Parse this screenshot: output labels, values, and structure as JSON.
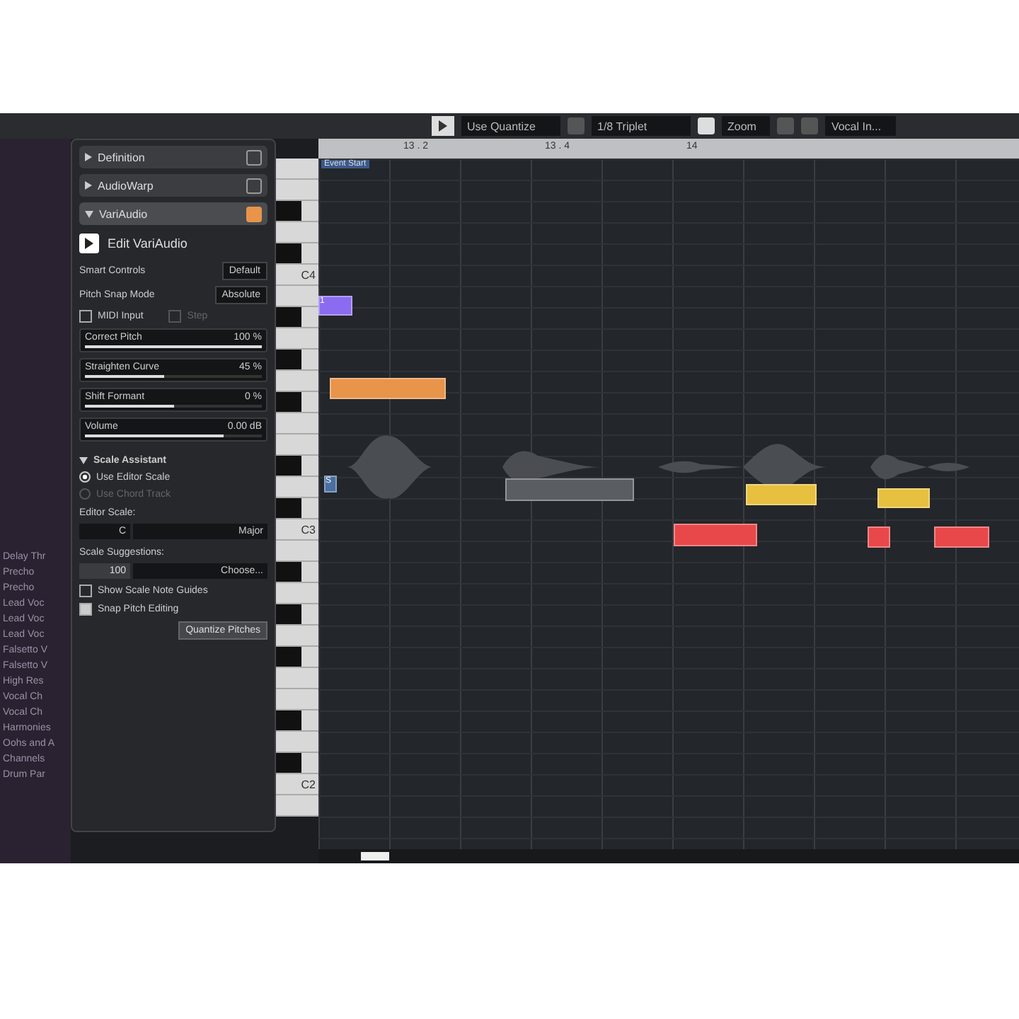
{
  "toolbar": {
    "quantize_mode": "Use Quantize",
    "quantize_value": "1/8 Triplet",
    "zoom": "Zoom",
    "track": "Vocal In..."
  },
  "track_list": [
    "Delay Thr",
    "Precho",
    "Precho",
    "Lead Voc",
    "Lead Voc",
    "Lead Voc",
    "Falsetto V",
    "Falsetto V",
    "High Res",
    "Vocal Ch",
    "Vocal Ch",
    "Harmonies",
    "Oohs and A",
    "Channels",
    "Drum Par"
  ],
  "inspector": {
    "sections": [
      {
        "label": "Definition",
        "expanded": false
      },
      {
        "label": "AudioWarp",
        "expanded": false
      },
      {
        "label": "VariAudio",
        "expanded": true,
        "on": true
      }
    ],
    "edit_button": "Edit VariAudio",
    "dropdowns": [
      {
        "label": "Smart Controls",
        "value": "Default"
      },
      {
        "label": "Pitch Snap Mode",
        "value": "Absolute"
      }
    ],
    "checks": [
      {
        "label": "MIDI Input",
        "checked": false,
        "disabled": false
      },
      {
        "label": "Step",
        "checked": false,
        "disabled": true
      }
    ],
    "sliders": [
      {
        "label": "Correct Pitch",
        "reading": "100 %",
        "level": 1.0
      },
      {
        "label": "Straighten Curve",
        "reading": "45 %",
        "level": 0.45
      },
      {
        "label": "Shift Formant",
        "reading": "0 %",
        "level": 0.5
      },
      {
        "label": "Volume",
        "reading": "0.00 dB",
        "level": 0.78
      }
    ],
    "scale_assistant": {
      "title": "Scale Assistant",
      "expanded": true,
      "radios": [
        {
          "label": "Use Editor Scale",
          "selected": true,
          "disabled": false
        },
        {
          "label": "Use Chord Track",
          "selected": false,
          "disabled": true
        }
      ],
      "editor_scale_label": "Editor Scale:",
      "root": "C",
      "mode": "Major",
      "suggestions_label": "Scale Suggestions:",
      "suggestion_value": "100",
      "suggestion_choice": "Choose...",
      "options": [
        {
          "label": "Show Scale Note Guides",
          "checked": false
        },
        {
          "label": "Snap Pitch Editing",
          "checked": true
        }
      ],
      "button": "Quantize Pitches"
    }
  },
  "ruler": {
    "marks": [
      "13 . 2",
      "13 . 4",
      "14"
    ],
    "event_label": "Event Start"
  },
  "keyboard_labels": [
    "C4",
    "C3",
    "C2"
  ],
  "notes": [
    {
      "color": "#8b6cf0",
      "label": "1"
    },
    {
      "color": "#e8944a"
    },
    {
      "color": "#5a5d61"
    },
    {
      "color": "#e8484a"
    },
    {
      "color": "#e8c040"
    },
    {
      "color": "#e8c040"
    },
    {
      "color": "#e8484a"
    },
    {
      "color": "#e8484a"
    },
    {
      "color": "#4a6fa0",
      "label": "S"
    }
  ]
}
